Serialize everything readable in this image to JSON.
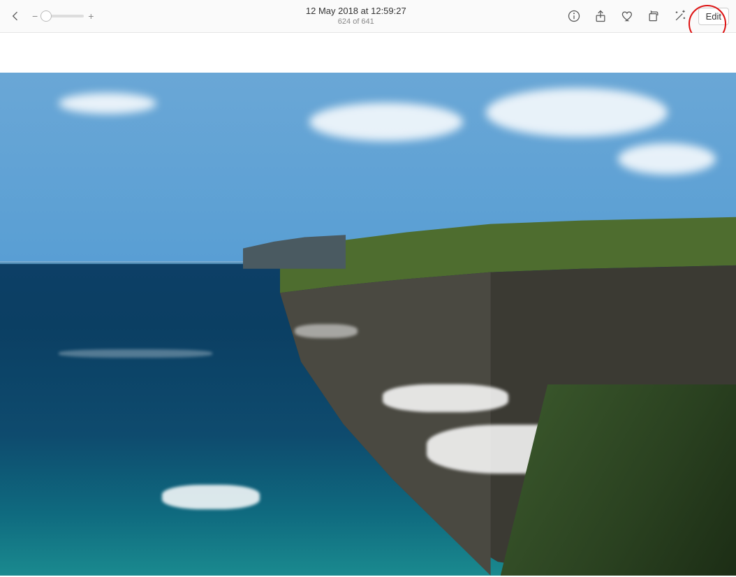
{
  "header": {
    "date_line": "12 May 2018 at 12:59:27",
    "position_line": "624 of 641",
    "edit_label": "Edit",
    "zoom_minus": "−",
    "zoom_plus": "+"
  }
}
